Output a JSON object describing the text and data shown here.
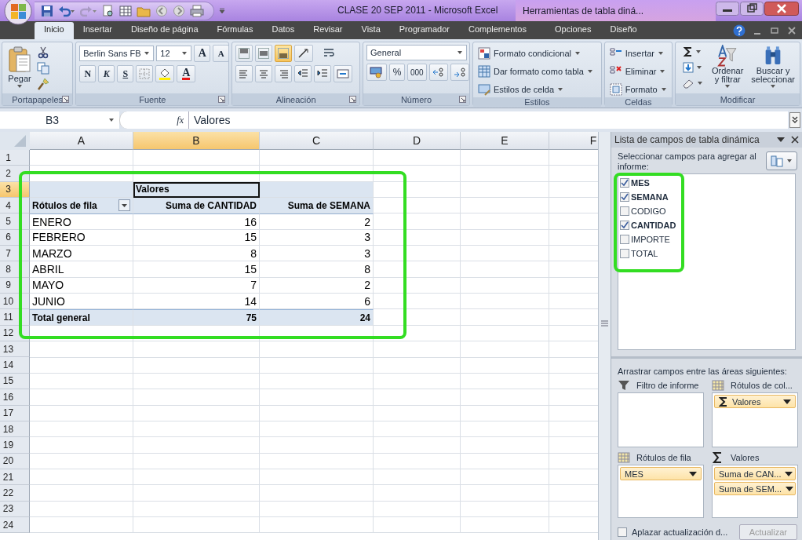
{
  "window": {
    "title": "CLASE 20 SEP 2011 - Microsoft Excel",
    "context_title": "Herramientas de tabla diná..."
  },
  "ribbon": {
    "tabs": [
      {
        "label": "Inicio",
        "selected": true
      },
      {
        "label": "Insertar",
        "selected": false
      },
      {
        "label": "Diseño de página",
        "selected": false
      },
      {
        "label": "Fórmulas",
        "selected": false
      },
      {
        "label": "Datos",
        "selected": false
      },
      {
        "label": "Revisar",
        "selected": false
      },
      {
        "label": "Vista",
        "selected": false
      },
      {
        "label": "Programador",
        "selected": false
      },
      {
        "label": "Complementos",
        "selected": false
      },
      {
        "label": "Opciones",
        "selected": false
      },
      {
        "label": "Diseño",
        "selected": false
      }
    ],
    "groups": [
      {
        "kind": "clipboard",
        "label": "Portapapeles",
        "launcher": true,
        "paste": "Pegar"
      },
      {
        "kind": "font",
        "label": "Fuente",
        "launcher": true,
        "font": "Berlin Sans FB",
        "size": "12",
        "grow": "A",
        "shrink": "A",
        "styles": [
          "N",
          "K",
          "S"
        ],
        "color_glyph": "A"
      },
      {
        "kind": "alignment",
        "label": "Alineación",
        "launcher": true,
        "vertical": [
          {
            "selected": false
          },
          {
            "selected": false
          },
          {
            "selected": true
          }
        ]
      },
      {
        "kind": "number",
        "label": "Número",
        "launcher": true,
        "format": "General",
        "percent": "%",
        "thousands": "000"
      },
      {
        "kind": "styles",
        "label": "Estilos",
        "launcher": false,
        "items": [
          "Formato condicional",
          "Dar formato como tabla",
          "Estilos de celda"
        ]
      },
      {
        "kind": "cells",
        "label": "Celdas",
        "launcher": false,
        "items": [
          "Insertar",
          "Eliminar",
          "Formato"
        ]
      },
      {
        "kind": "editing",
        "label": "Modificar",
        "launcher": false,
        "items": [
          "Ordenar\ny filtrar",
          "Buscar y\nseleccionar"
        ]
      }
    ]
  },
  "formula_bar": {
    "name_box": "B3",
    "function": "fx",
    "value": "Valores"
  },
  "sheet": {
    "columns": [
      {
        "label": "A",
        "selected": false
      },
      {
        "label": "B",
        "selected": true
      },
      {
        "label": "C",
        "selected": false
      },
      {
        "label": "D",
        "selected": false
      },
      {
        "label": "E",
        "selected": false
      },
      {
        "label": "F",
        "selected": false
      }
    ],
    "rows": [
      {
        "label": "1",
        "selected": false
      },
      {
        "label": "2",
        "selected": false
      },
      {
        "label": "3",
        "selected": true
      },
      {
        "label": "4",
        "selected": false
      },
      {
        "label": "5",
        "selected": false
      },
      {
        "label": "6",
        "selected": false
      },
      {
        "label": "7",
        "selected": false
      },
      {
        "label": "8",
        "selected": false
      },
      {
        "label": "9",
        "selected": false
      },
      {
        "label": "10",
        "selected": false
      },
      {
        "label": "11",
        "selected": false
      },
      {
        "label": "12",
        "selected": false
      },
      {
        "label": "13",
        "selected": false
      },
      {
        "label": "14",
        "selected": false
      },
      {
        "label": "15",
        "selected": false
      },
      {
        "label": "16",
        "selected": false
      },
      {
        "label": "17",
        "selected": false
      },
      {
        "label": "18",
        "selected": false
      },
      {
        "label": "19",
        "selected": false
      },
      {
        "label": "20",
        "selected": false
      },
      {
        "label": "21",
        "selected": false
      },
      {
        "label": "22",
        "selected": false
      },
      {
        "label": "23",
        "selected": false
      },
      {
        "label": "24",
        "selected": false
      }
    ]
  },
  "pivot_table": {
    "highlighted": true,
    "values_header": "Valores",
    "values_header_active": true,
    "row_header": "Rótulos de fila",
    "column_headers": [
      "Suma de CANTIDAD",
      "Suma de SEMANA"
    ],
    "rows": [
      {
        "label": "ENERO",
        "values": [
          "16",
          "2"
        ]
      },
      {
        "label": "FEBRERO",
        "values": [
          "15",
          "3"
        ]
      },
      {
        "label": "MARZO",
        "values": [
          "8",
          "3"
        ]
      },
      {
        "label": "ABRIL",
        "values": [
          "15",
          "8"
        ]
      },
      {
        "label": "MAYO",
        "values": [
          "7",
          "2"
        ]
      },
      {
        "label": "JUNIO",
        "values": [
          "14",
          "6"
        ]
      }
    ],
    "total": {
      "label": "Total general",
      "values": [
        "75",
        "24"
      ]
    }
  },
  "field_list": {
    "title": "Lista de campos de tabla dinámica",
    "prompt": "Seleccionar campos para agregar al informe:",
    "highlighted": true,
    "fields": [
      {
        "label": "MES",
        "checked": true
      },
      {
        "label": "SEMANA",
        "checked": true
      },
      {
        "label": "CODIGO",
        "checked": false
      },
      {
        "label": "CANTIDAD",
        "checked": true
      },
      {
        "label": "IMPORTE",
        "checked": false
      },
      {
        "label": "TOTAL",
        "checked": false
      }
    ],
    "areas_prompt": "Arrastrar campos entre las áreas siguientes:",
    "areas": [
      {
        "kind": "filter",
        "label": "Filtro de informe"
      },
      {
        "kind": "columns",
        "label": "Rótulos de col...",
        "items": [
          {
            "label": "Valores",
            "sigma": true
          }
        ]
      },
      {
        "kind": "rows",
        "label": "Rótulos de fila",
        "items": [
          {
            "label": "MES",
            "sigma": false
          }
        ]
      },
      {
        "kind": "values",
        "label": "Valores",
        "items": [
          {
            "label": "Suma de CAN...",
            "sigma": false
          },
          {
            "label": "Suma de SEM...",
            "sigma": false
          }
        ]
      }
    ],
    "defer": {
      "label": "Aplazar actualización d...",
      "checked": false
    },
    "update_button": {
      "label": "Actualizar",
      "disabled": true
    }
  }
}
